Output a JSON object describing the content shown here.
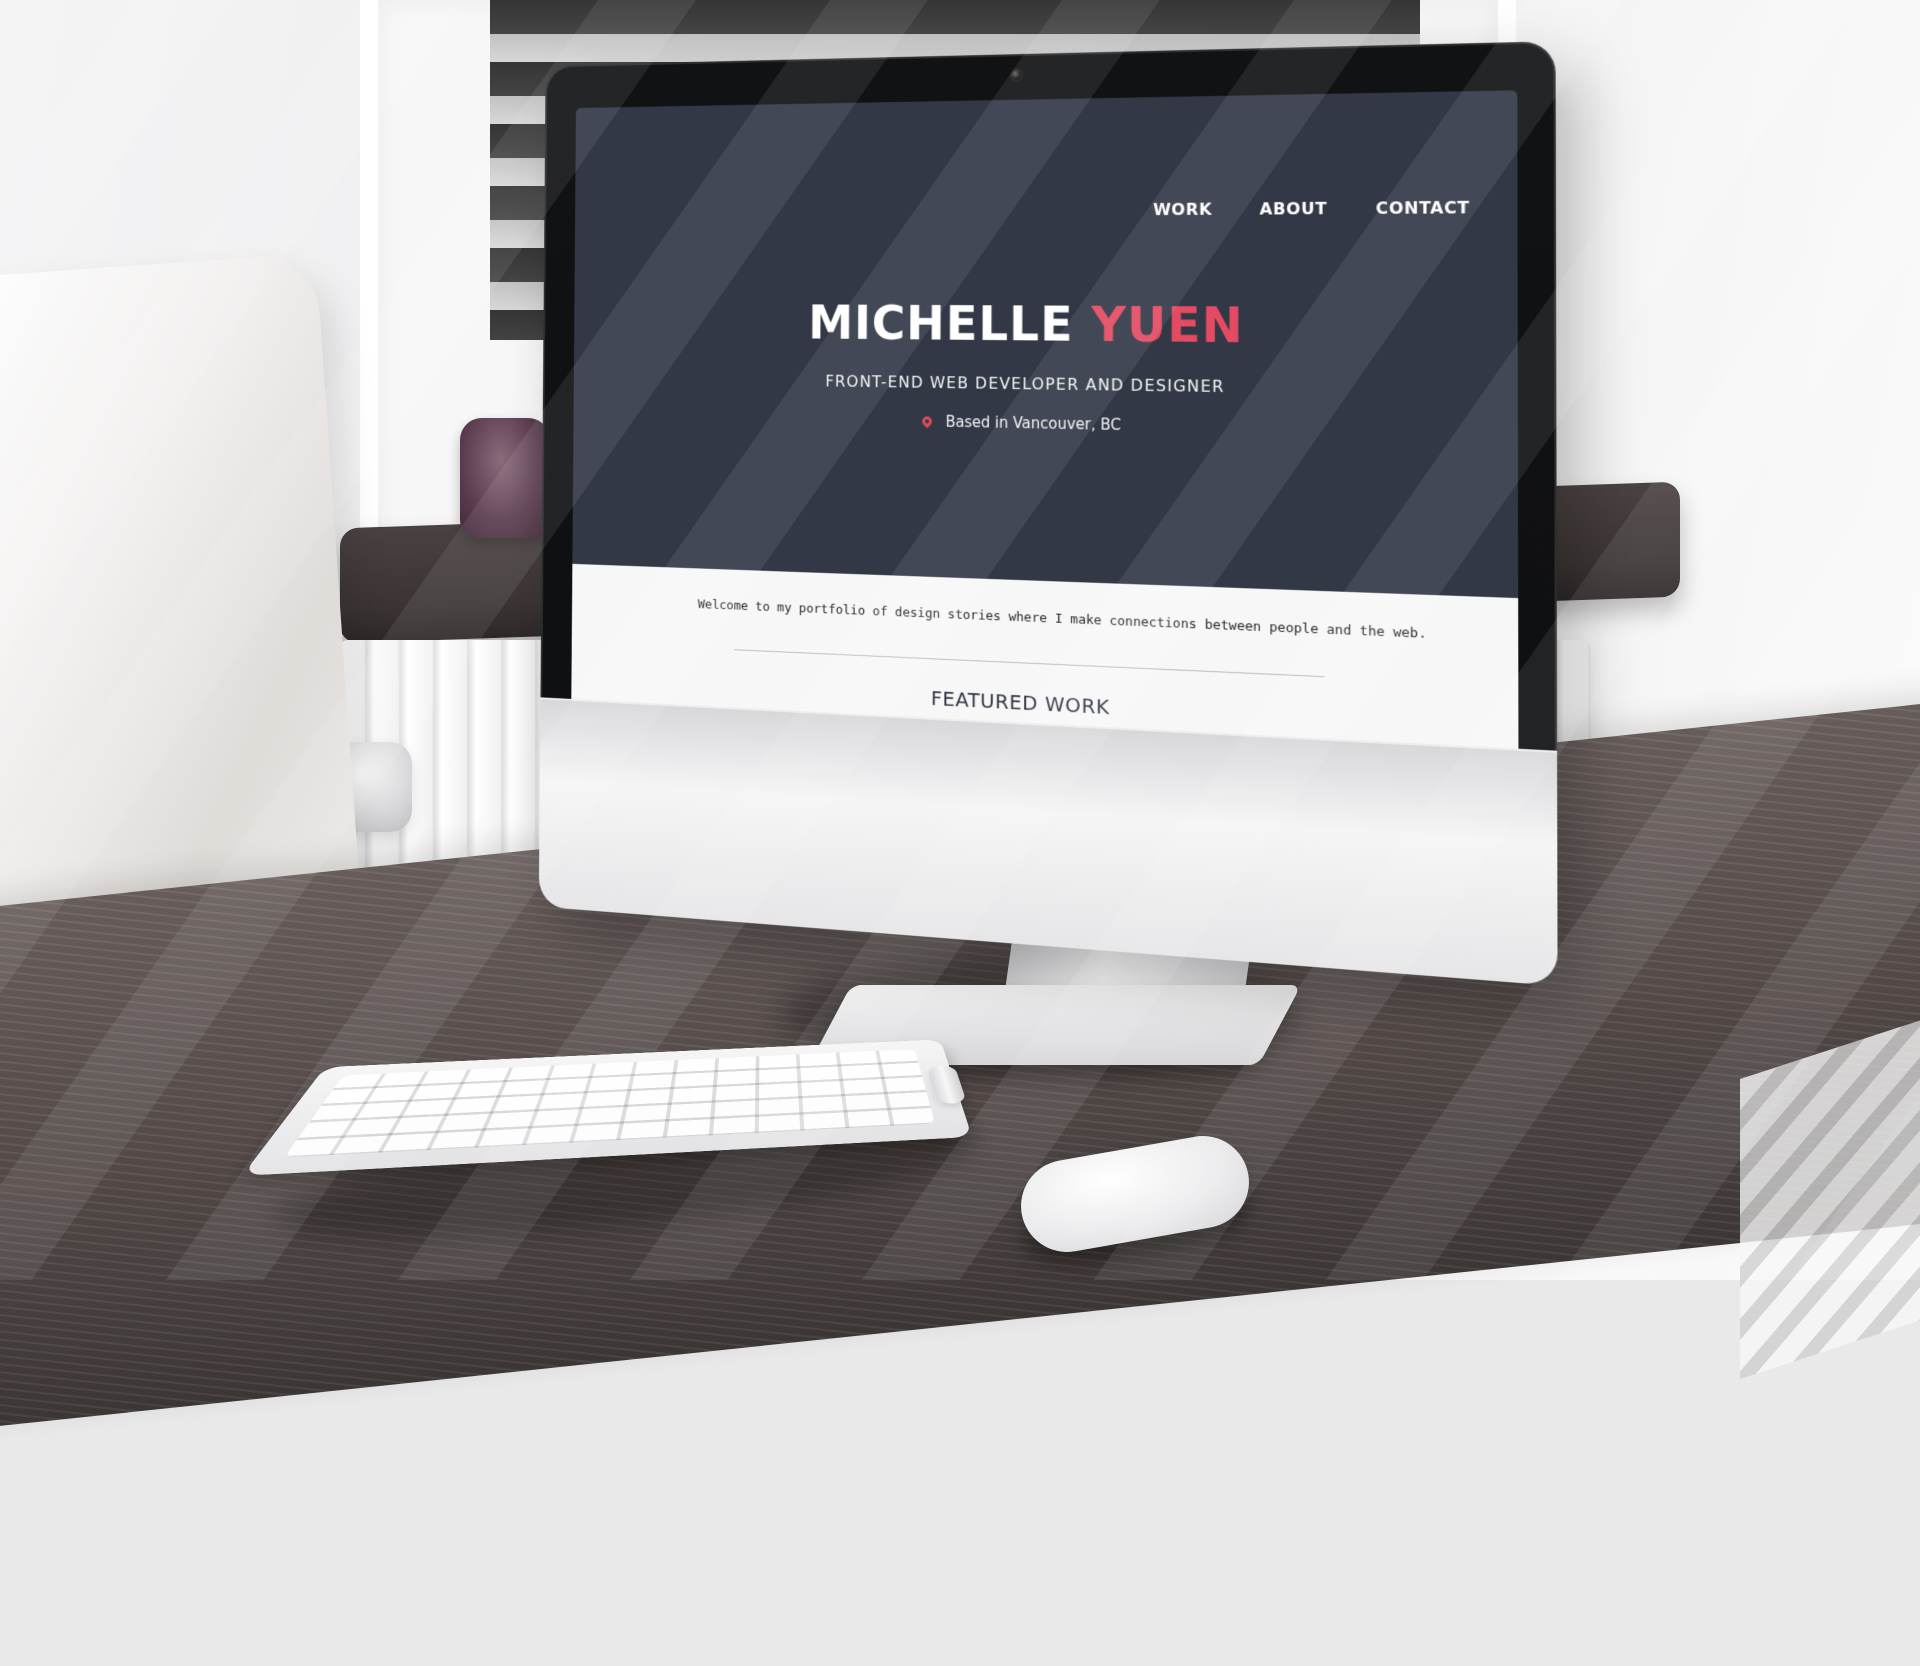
{
  "website": {
    "nav": {
      "items": [
        {
          "label": "WORK"
        },
        {
          "label": "ABOUT"
        },
        {
          "label": "CONTACT"
        }
      ]
    },
    "hero": {
      "name_first": "MICHELLE",
      "name_last": "YUEN",
      "subtitle": "FRONT-END WEB DEVELOPER AND DESIGNER",
      "location_icon": "map-pin-icon",
      "location": "Based in Vancouver, BC"
    },
    "content": {
      "intro": "Welcome to my portfolio of design stories where I make connections between people and the web.",
      "section_title": "FEATURED WORK"
    },
    "colors": {
      "hero_bg": "#323846",
      "accent": "#e34b63",
      "page_bg": "#f7f7f7"
    }
  },
  "device": {
    "brand_icon": "apple-logo-icon"
  }
}
